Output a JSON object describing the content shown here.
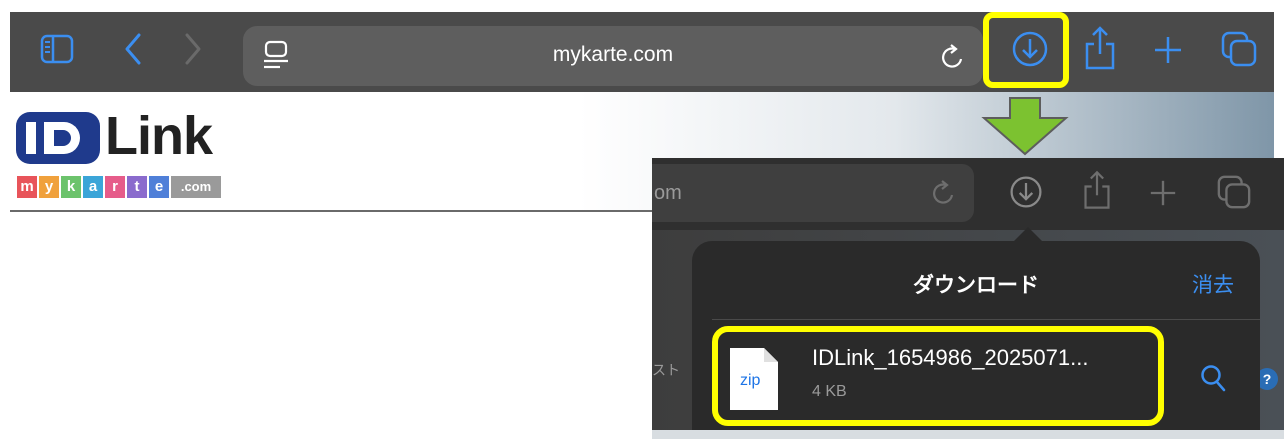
{
  "browser": {
    "url": "mykarte.com",
    "url_partial": "om"
  },
  "logo": {
    "brand_text": "Link",
    "id_text": "ID",
    "letters": [
      "m",
      "y",
      "k",
      "a",
      "r",
      "t",
      "e"
    ],
    "letter_colors": [
      "#e8545a",
      "#f0a13c",
      "#6cc36c",
      "#3ba5d8",
      "#e65c8a",
      "#8a6bcd",
      "#4f7fd8"
    ],
    "domain": ".com"
  },
  "downloads": {
    "title": "ダウンロード",
    "clear_label": "消去",
    "file": {
      "type_label": "zip",
      "name": "IDLink_1654986_2025071...",
      "size": "4 KB"
    }
  },
  "background_hint": "スト",
  "help_glyph": "?",
  "colors": {
    "highlight": "#ffff00",
    "arrow": "#7cc230",
    "accent": "#3b8ef0"
  }
}
